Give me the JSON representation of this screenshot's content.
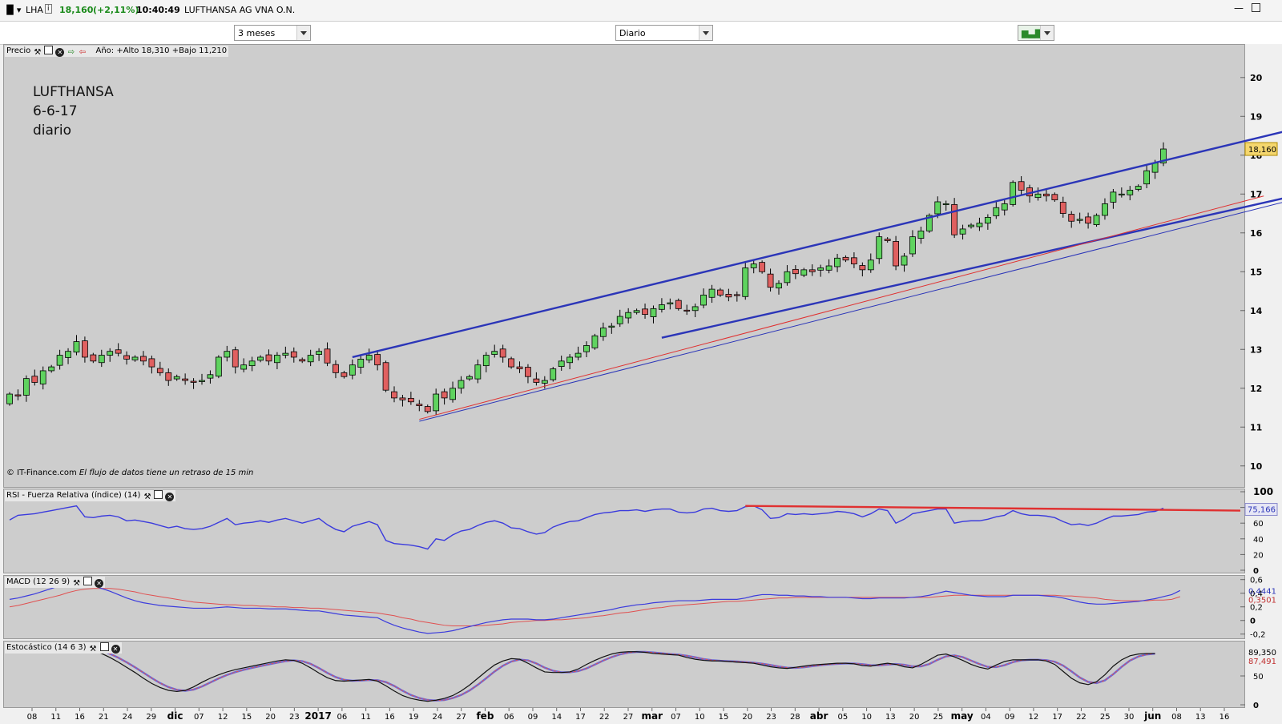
{
  "window": {
    "symbol": "LHA",
    "last": "18,160",
    "change": "(+2,11%)",
    "time": "10:40:49",
    "name": "LUFTHANSA AG VNA O.N."
  },
  "toolbar": {
    "period": "3 meses",
    "interval": "Diario"
  },
  "price_panel": {
    "label": "Precio",
    "year_info": "Año: +Alto 18,310 +Bajo 11,210",
    "annotation": [
      "LUFTHANSA",
      "6-6-17",
      "diario"
    ],
    "copyright": "© IT-Finance.com",
    "disclaimer": "El flujo de datos tiene un retraso de 15 min",
    "last_badge": "18,160"
  },
  "rsi_panel": {
    "label": "RSI - Fuerza Relativa (índice) (14)",
    "value": "75,166"
  },
  "macd_panel": {
    "label": "MACD (12 26 9)",
    "value1": "0,4441",
    "value2": "0,3501"
  },
  "stoch_panel": {
    "label": "Estocástico (14 6 3)",
    "value1": "89,350",
    "value2": "87,491"
  },
  "colors": {
    "up": "#5fd35f",
    "down": "#e06060",
    "channel": "#2b35b8",
    "trend": "#e03030",
    "rsi": "#3b3bdd",
    "signal": "#e05050"
  },
  "chart_data": [
    {
      "type": "candlestick",
      "ylim": [
        9.5,
        20.8
      ],
      "yticks": [
        10,
        11,
        12,
        13,
        14,
        15,
        16,
        17,
        18,
        19,
        20
      ],
      "xticks": [
        "08",
        "11",
        "16",
        "21",
        "24",
        "29",
        "dic",
        "07",
        "12",
        "15",
        "20",
        "23",
        "2017",
        "06",
        "11",
        "16",
        "19",
        "24",
        "27",
        "feb",
        "06",
        "09",
        "14",
        "17",
        "22",
        "27",
        "mar",
        "07",
        "10",
        "15",
        "20",
        "23",
        "28",
        "abr",
        "05",
        "10",
        "13",
        "20",
        "25",
        "may",
        "04",
        "09",
        "12",
        "17",
        "22",
        "25",
        "30",
        "jun",
        "08",
        "13",
        "16"
      ],
      "closes": [
        11.85,
        11.8,
        12.25,
        12.15,
        12.45,
        12.55,
        12.85,
        12.95,
        13.2,
        12.8,
        12.7,
        12.85,
        12.95,
        12.9,
        12.75,
        12.8,
        12.7,
        12.55,
        12.4,
        12.2,
        12.3,
        12.2,
        12.15,
        12.2,
        12.35,
        12.8,
        12.95,
        12.55,
        12.6,
        12.7,
        12.8,
        12.7,
        12.85,
        12.9,
        12.8,
        12.7,
        12.85,
        12.95,
        12.65,
        12.4,
        12.3,
        12.6,
        12.75,
        12.85,
        12.6,
        11.95,
        11.75,
        11.7,
        11.65,
        11.55,
        11.4,
        11.85,
        11.75,
        12.0,
        12.2,
        12.3,
        12.6,
        12.85,
        12.95,
        12.8,
        12.55,
        12.5,
        12.3,
        12.15,
        12.2,
        12.5,
        12.7,
        12.8,
        12.9,
        13.1,
        13.35,
        13.55,
        13.6,
        13.85,
        13.95,
        14.0,
        13.9,
        14.05,
        14.15,
        14.2,
        14.05,
        14.0,
        14.1,
        14.4,
        14.55,
        14.4,
        14.35,
        14.4,
        15.1,
        15.2,
        15.0,
        14.6,
        14.7,
        15.0,
        14.95,
        15.05,
        15.0,
        15.1,
        15.15,
        15.35,
        15.3,
        15.2,
        15.05,
        15.3,
        15.9,
        15.8,
        15.15,
        15.4,
        15.9,
        16.05,
        16.45,
        16.8,
        16.75,
        15.95,
        16.1,
        16.2,
        16.25,
        16.4,
        16.65,
        16.75,
        17.3,
        17.1,
        16.95,
        17.0,
        16.95,
        16.85,
        16.5,
        16.3,
        16.35,
        16.25,
        16.45,
        16.75,
        17.05,
        17.0,
        17.1,
        17.2,
        17.6,
        17.8,
        18.16
      ]
    },
    {
      "type": "line",
      "name": "RSI",
      "ylim": [
        0,
        100
      ],
      "yticks": [
        0,
        20,
        40,
        60,
        80,
        100
      ],
      "values": [
        64,
        70,
        71,
        72,
        74,
        76,
        78,
        80,
        82,
        68,
        67,
        69,
        70,
        68,
        63,
        64,
        62,
        60,
        57,
        54,
        56,
        53,
        52,
        53,
        56,
        61,
        66,
        58,
        60,
        61,
        63,
        61,
        64,
        66,
        63,
        60,
        63,
        66,
        58,
        52,
        49,
        56,
        59,
        62,
        58,
        38,
        34,
        33,
        32,
        30,
        27,
        40,
        38,
        45,
        50,
        52,
        57,
        61,
        63,
        60,
        54,
        53,
        49,
        46,
        48,
        55,
        59,
        62,
        63,
        67,
        71,
        73,
        74,
        76,
        76,
        77,
        75,
        77,
        78,
        78,
        74,
        73,
        74,
        78,
        79,
        76,
        75,
        76,
        81,
        82,
        77,
        66,
        67,
        72,
        71,
        72,
        71,
        72,
        73,
        75,
        74,
        72,
        68,
        72,
        78,
        76,
        60,
        65,
        72,
        74,
        76,
        78,
        78,
        60,
        62,
        63,
        63,
        65,
        68,
        70,
        76,
        72,
        70,
        70,
        69,
        67,
        62,
        58,
        59,
        57,
        60,
        65,
        69,
        69,
        70,
        71,
        74,
        75,
        79
      ]
    },
    {
      "type": "line",
      "name": "MACD",
      "ylim": [
        -0.25,
        0.62
      ],
      "yticks": [
        -0.2,
        0,
        0.2,
        0.4,
        0.6
      ],
      "macd": [
        0.31,
        0.33,
        0.36,
        0.39,
        0.43,
        0.47,
        0.51,
        0.55,
        0.6,
        0.56,
        0.51,
        0.47,
        0.43,
        0.38,
        0.33,
        0.29,
        0.26,
        0.24,
        0.22,
        0.21,
        0.2,
        0.19,
        0.18,
        0.18,
        0.18,
        0.19,
        0.2,
        0.19,
        0.18,
        0.18,
        0.18,
        0.17,
        0.17,
        0.17,
        0.16,
        0.15,
        0.14,
        0.14,
        0.12,
        0.1,
        0.08,
        0.07,
        0.06,
        0.05,
        0.04,
        -0.02,
        -0.07,
        -0.11,
        -0.14,
        -0.17,
        -0.19,
        -0.18,
        -0.17,
        -0.15,
        -0.12,
        -0.09,
        -0.06,
        -0.03,
        -0.01,
        0.01,
        0.02,
        0.02,
        0.02,
        0.01,
        0.01,
        0.02,
        0.04,
        0.06,
        0.08,
        0.1,
        0.12,
        0.14,
        0.16,
        0.19,
        0.21,
        0.23,
        0.24,
        0.26,
        0.27,
        0.28,
        0.29,
        0.29,
        0.29,
        0.3,
        0.31,
        0.31,
        0.31,
        0.31,
        0.33,
        0.36,
        0.38,
        0.38,
        0.37,
        0.37,
        0.36,
        0.36,
        0.35,
        0.35,
        0.34,
        0.34,
        0.34,
        0.33,
        0.32,
        0.32,
        0.33,
        0.33,
        0.33,
        0.33,
        0.34,
        0.35,
        0.37,
        0.4,
        0.43,
        0.41,
        0.39,
        0.37,
        0.36,
        0.35,
        0.35,
        0.35,
        0.37,
        0.37,
        0.37,
        0.37,
        0.36,
        0.35,
        0.33,
        0.3,
        0.27,
        0.25,
        0.24,
        0.24,
        0.25,
        0.26,
        0.27,
        0.28,
        0.3,
        0.32,
        0.35,
        0.38,
        0.44
      ],
      "signal": [
        0.2,
        0.22,
        0.25,
        0.28,
        0.31,
        0.34,
        0.37,
        0.41,
        0.44,
        0.46,
        0.47,
        0.47,
        0.47,
        0.46,
        0.44,
        0.42,
        0.39,
        0.37,
        0.35,
        0.33,
        0.31,
        0.29,
        0.27,
        0.26,
        0.25,
        0.24,
        0.23,
        0.23,
        0.22,
        0.22,
        0.21,
        0.21,
        0.2,
        0.2,
        0.19,
        0.19,
        0.18,
        0.18,
        0.17,
        0.16,
        0.15,
        0.14,
        0.13,
        0.12,
        0.11,
        0.09,
        0.07,
        0.04,
        0.02,
        -0.01,
        -0.03,
        -0.05,
        -0.07,
        -0.08,
        -0.08,
        -0.08,
        -0.08,
        -0.07,
        -0.06,
        -0.05,
        -0.03,
        -0.02,
        -0.01,
        0,
        0,
        0.01,
        0.01,
        0.02,
        0.03,
        0.04,
        0.06,
        0.07,
        0.09,
        0.11,
        0.12,
        0.14,
        0.16,
        0.18,
        0.19,
        0.21,
        0.22,
        0.23,
        0.24,
        0.25,
        0.26,
        0.27,
        0.28,
        0.28,
        0.29,
        0.3,
        0.31,
        0.32,
        0.33,
        0.33,
        0.34,
        0.34,
        0.34,
        0.34,
        0.34,
        0.34,
        0.34,
        0.34,
        0.34,
        0.34,
        0.34,
        0.34,
        0.34,
        0.34,
        0.34,
        0.34,
        0.34,
        0.35,
        0.36,
        0.37,
        0.37,
        0.37,
        0.37,
        0.37,
        0.37,
        0.37,
        0.37,
        0.37,
        0.37,
        0.37,
        0.37,
        0.37,
        0.36,
        0.36,
        0.35,
        0.34,
        0.33,
        0.31,
        0.3,
        0.29,
        0.29,
        0.29,
        0.29,
        0.3,
        0.3,
        0.31,
        0.35
      ]
    },
    {
      "type": "line",
      "name": "Estocástico",
      "ylim": [
        0,
        100
      ],
      "yticks": [
        0,
        50
      ],
      "k": [
        100,
        100,
        100,
        100,
        100,
        100,
        100,
        100,
        100,
        98,
        94,
        89,
        82,
        74,
        65,
        56,
        46,
        37,
        30,
        25,
        23,
        25,
        31,
        39,
        46,
        52,
        57,
        61,
        64,
        67,
        70,
        73,
        76,
        78,
        77,
        72,
        64,
        55,
        47,
        42,
        41,
        42,
        43,
        44,
        41,
        33,
        24,
        16,
        11,
        8,
        6,
        8,
        11,
        16,
        24,
        34,
        46,
        58,
        69,
        76,
        80,
        79,
        72,
        64,
        57,
        56,
        56,
        57,
        62,
        70,
        77,
        83,
        88,
        91,
        92,
        92,
        91,
        89,
        88,
        87,
        86,
        82,
        79,
        77,
        76,
        76,
        75,
        74,
        73,
        72,
        69,
        66,
        64,
        63,
        65,
        67,
        69,
        70,
        71,
        72,
        72,
        71,
        68,
        67,
        70,
        72,
        70,
        66,
        64,
        70,
        78,
        86,
        88,
        83,
        77,
        70,
        65,
        62,
        69,
        75,
        78,
        78,
        78,
        78,
        76,
        70,
        58,
        46,
        38,
        35,
        40,
        52,
        67,
        78,
        85,
        88,
        89,
        89
      ]
    }
  ]
}
